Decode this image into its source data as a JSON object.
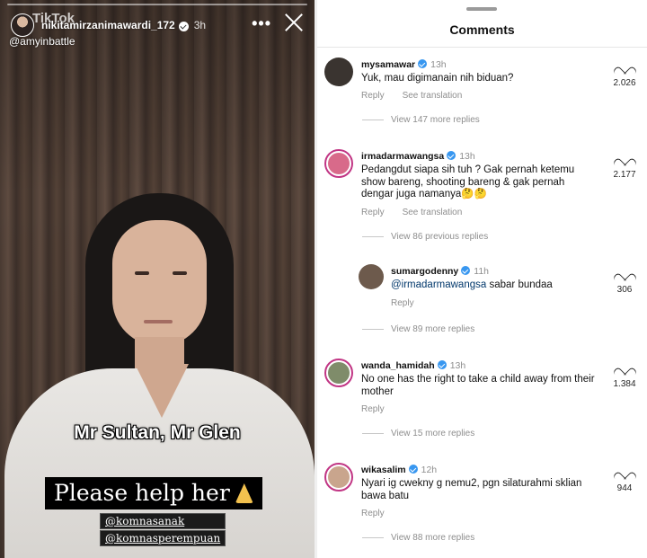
{
  "story": {
    "watermark": "TikTok",
    "username": "nikitamirzanimawardi_172",
    "time": "3h",
    "more_label": "•••",
    "handle": "@amyinbattle",
    "caption_line1": "Mr Sultan, Mr Glen",
    "caption_line2": "Please help her",
    "mentions": [
      "@komnasanak",
      "@komnasperempuan"
    ]
  },
  "comments_panel": {
    "title": "Comments",
    "items": [
      {
        "username": "mysamawar",
        "time": "13h",
        "text": "Yuk, mau digimanain nih biduan?",
        "reply": "Reply",
        "translate": "See translation",
        "likes": "2.026",
        "view_more": "View 147 more replies",
        "avatar_color": "#3a3430"
      },
      {
        "username": "irmadarmawangsa",
        "time": "13h",
        "text": "Pedangdut siapa sih tuh ? Gak pernah ketemu show bareng, shooting bareng & gak pernah dengar juga namanya🤔🤔",
        "reply": "Reply",
        "translate": "See translation",
        "likes": "2.177",
        "view_more": "View 86 previous replies",
        "avatar_color": "#d86a8a"
      },
      {
        "username": "sumargodenny",
        "time": "11h",
        "mention": "@irmadarmawangsa",
        "text": "sabar bundaa",
        "reply": "Reply",
        "likes": "306",
        "view_more": "View 89 more replies",
        "avatar_color": "#6d5a4c"
      },
      {
        "username": "wanda_hamidah",
        "time": "13h",
        "text": "No one has the right to take a child away from their mother",
        "reply": "Reply",
        "likes": "1.384",
        "view_more": "View 15 more replies",
        "avatar_color": "#7f8c6a"
      },
      {
        "username": "wikasalim",
        "time": "12h",
        "text": "Nyari ig cwekny g nemu2, pgn silaturahmi sklian bawa batu",
        "reply": "Reply",
        "likes": "944",
        "view_more": "View 88 more replies",
        "avatar_color": "#c9a58d"
      }
    ]
  }
}
